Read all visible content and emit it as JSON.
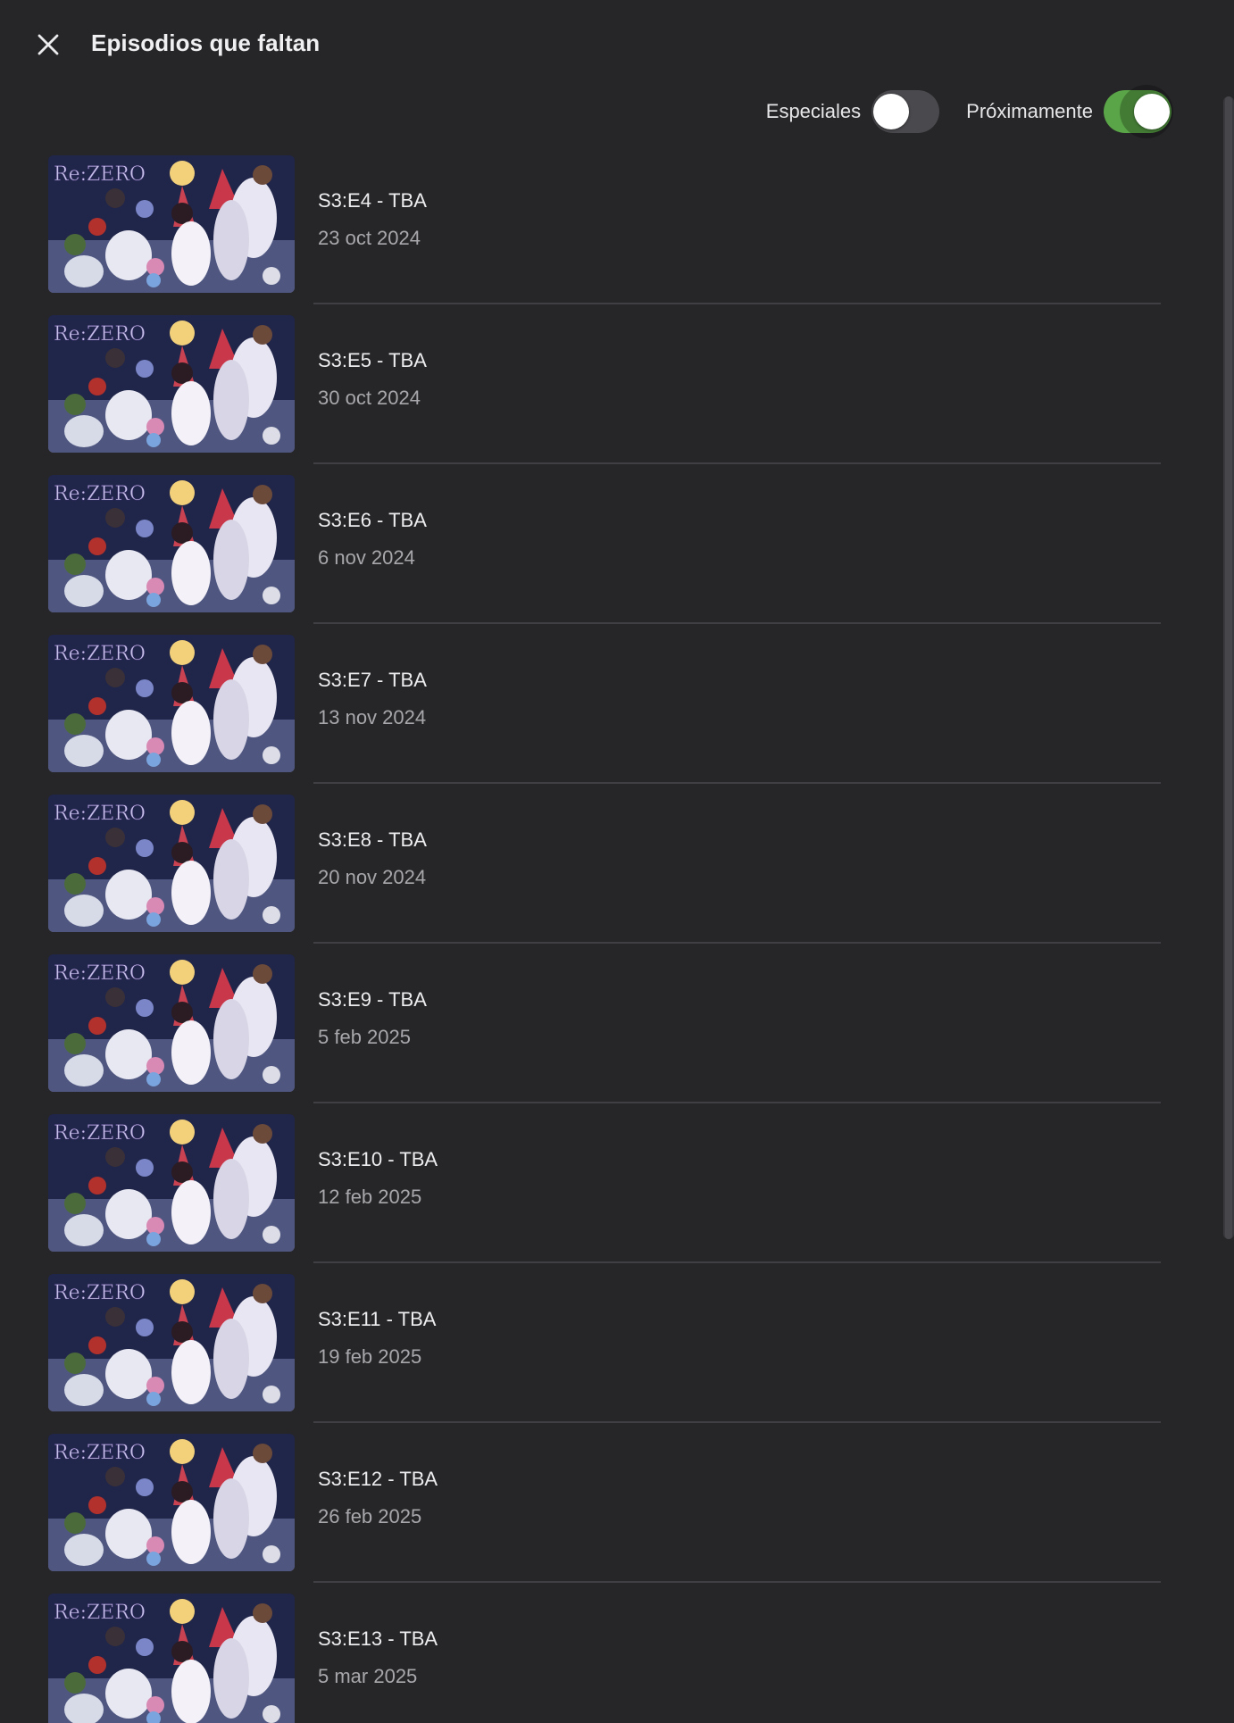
{
  "header": {
    "title": "Episodios que faltan",
    "close_icon": "close-icon"
  },
  "filters": {
    "specials": {
      "label": "Especiales",
      "enabled": false
    },
    "upcoming": {
      "label": "Próximamente",
      "enabled": true
    },
    "accent_color": "#5aa547"
  },
  "episodes": [
    {
      "title": "S3:E4 - TBA",
      "date": "23 oct 2024"
    },
    {
      "title": "S3:E5 - TBA",
      "date": "30 oct 2024"
    },
    {
      "title": "S3:E6 - TBA",
      "date": "6 nov 2024"
    },
    {
      "title": "S3:E7 - TBA",
      "date": "13 nov 2024"
    },
    {
      "title": "S3:E8 - TBA",
      "date": "20 nov 2024"
    },
    {
      "title": "S3:E9 - TBA",
      "date": "5 feb 2025"
    },
    {
      "title": "S3:E10 - TBA",
      "date": "12 feb 2025"
    },
    {
      "title": "S3:E11 - TBA",
      "date": "19 feb 2025"
    },
    {
      "title": "S3:E12 - TBA",
      "date": "26 feb 2025"
    },
    {
      "title": "S3:E13 - TBA",
      "date": "5 mar 2025"
    }
  ],
  "thumbnail": {
    "logo_text": "Re:ZERO"
  }
}
